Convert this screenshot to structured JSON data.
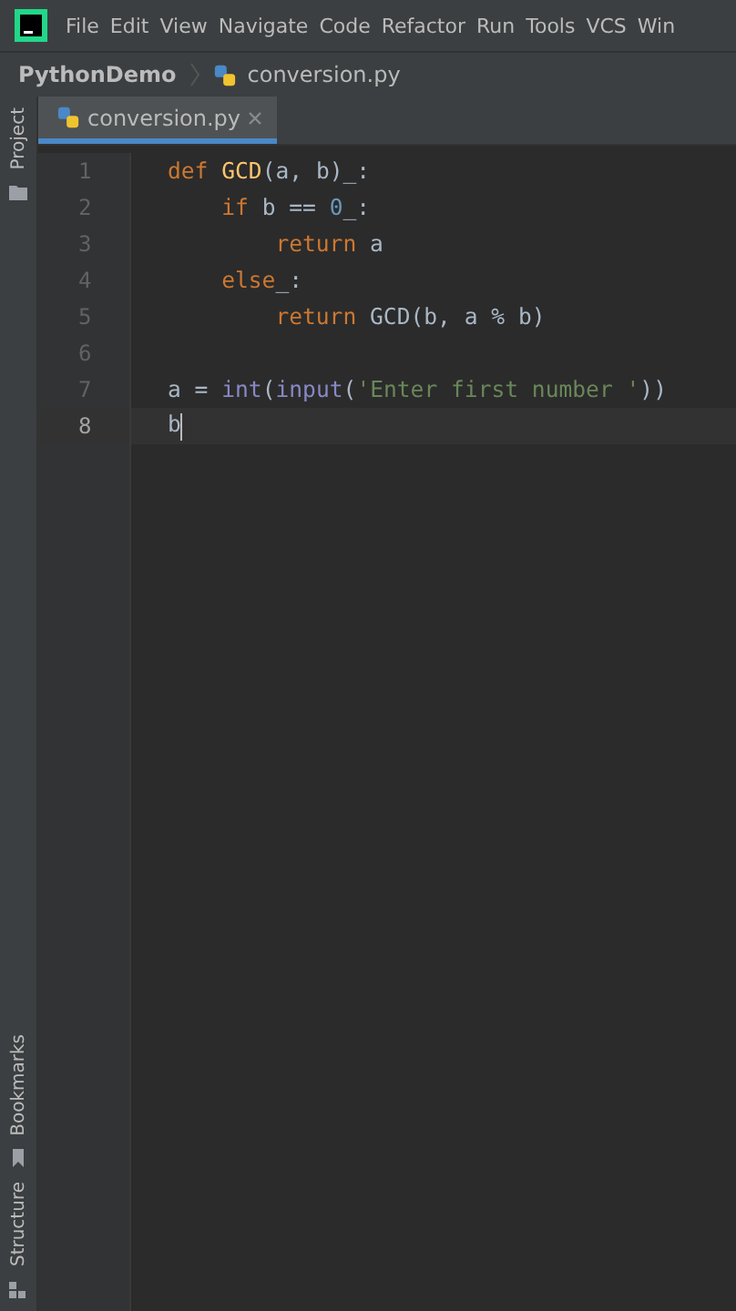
{
  "menu_bar": {
    "items": [
      "File",
      "Edit",
      "View",
      "Navigate",
      "Code",
      "Refactor",
      "Run",
      "Tools",
      "VCS",
      "Win"
    ]
  },
  "breadcrumb": {
    "project": "PythonDemo",
    "file": "conversion.py"
  },
  "tabs": [
    {
      "label": "conversion.py",
      "selected": true
    }
  ],
  "tool_strip": {
    "top": [
      "Project"
    ],
    "bottom": [
      "Bookmarks",
      "Structure"
    ]
  },
  "editor": {
    "lines": [
      {
        "number": "1",
        "current": false,
        "tokens": [
          {
            "kind": "keyword",
            "text": "def "
          },
          {
            "kind": "func",
            "text": "GCD"
          },
          {
            "kind": "plain",
            "text": "(a, b)_:"
          }
        ],
        "children": [
          {
            "number": "2",
            "current": false,
            "tokens": [
              {
                "kind": "keyword",
                "text": "if "
              },
              {
                "kind": "plain",
                "text": "b == "
              },
              {
                "kind": "number",
                "text": "0"
              },
              {
                "kind": "plain",
                "text": "_:"
              }
            ],
            "children": [
              {
                "number": "3",
                "current": false,
                "tokens": [
                  {
                    "kind": "keyword",
                    "text": "return "
                  },
                  {
                    "kind": "plain",
                    "text": "a"
                  }
                ]
              }
            ]
          },
          {
            "number": "4",
            "current": false,
            "tokens": [
              {
                "kind": "keyword",
                "text": "else"
              },
              {
                "kind": "plain",
                "text": "_:"
              }
            ],
            "children": [
              {
                "number": "5",
                "current": false,
                "tokens": [
                  {
                    "kind": "keyword",
                    "text": "return "
                  },
                  {
                    "kind": "plain",
                    "text": "GCD(b, a % b)"
                  }
                ]
              }
            ]
          }
        ]
      },
      {
        "number": "6",
        "current": false
      },
      {
        "number": "7",
        "current": false,
        "tokens": [
          {
            "kind": "plain",
            "text": "a = "
          },
          {
            "kind": "builtin",
            "text": "int"
          },
          {
            "kind": "plain",
            "text": "("
          },
          {
            "kind": "builtin",
            "text": "input"
          },
          {
            "kind": "plain",
            "text": "("
          },
          {
            "kind": "string",
            "text": "'Enter first number '"
          },
          {
            "kind": "plain",
            "text": "))"
          }
        ]
      },
      {
        "number": "8",
        "current": true,
        "tokens": [
          {
            "kind": "plain",
            "text": "b"
          }
        ]
      }
    ]
  }
}
